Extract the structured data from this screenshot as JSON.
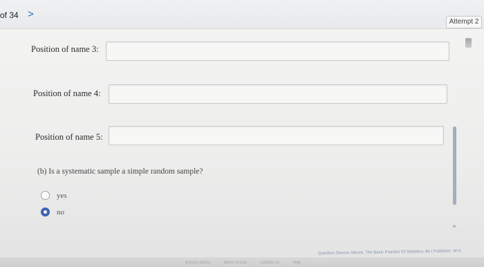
{
  "header": {
    "page_counter": "of 34",
    "next_glyph": ">",
    "attempt": "Attempt 2"
  },
  "fields": [
    {
      "label": "Position of name 3:",
      "value": ""
    },
    {
      "label": "Position of name 4:",
      "value": ""
    },
    {
      "label": "Position of name 5:",
      "value": ""
    }
  ],
  "question_b": {
    "prompt": "(b) Is a systematic sample a simple random sample?",
    "options": [
      {
        "label": "yes",
        "selected": false
      },
      {
        "label": "no",
        "selected": true
      }
    ]
  },
  "source_note": "Question Source: Moore, The Basic Practice Of Statistics, 8e  |  Publisher: W.H.",
  "footer": {
    "links": [
      "privacy policy",
      "terms of use",
      "contact us",
      "help"
    ]
  },
  "colors": {
    "accent": "#3d63b8",
    "link": "#2a66b8"
  },
  "icons": {
    "next": "chevron-right-icon"
  }
}
